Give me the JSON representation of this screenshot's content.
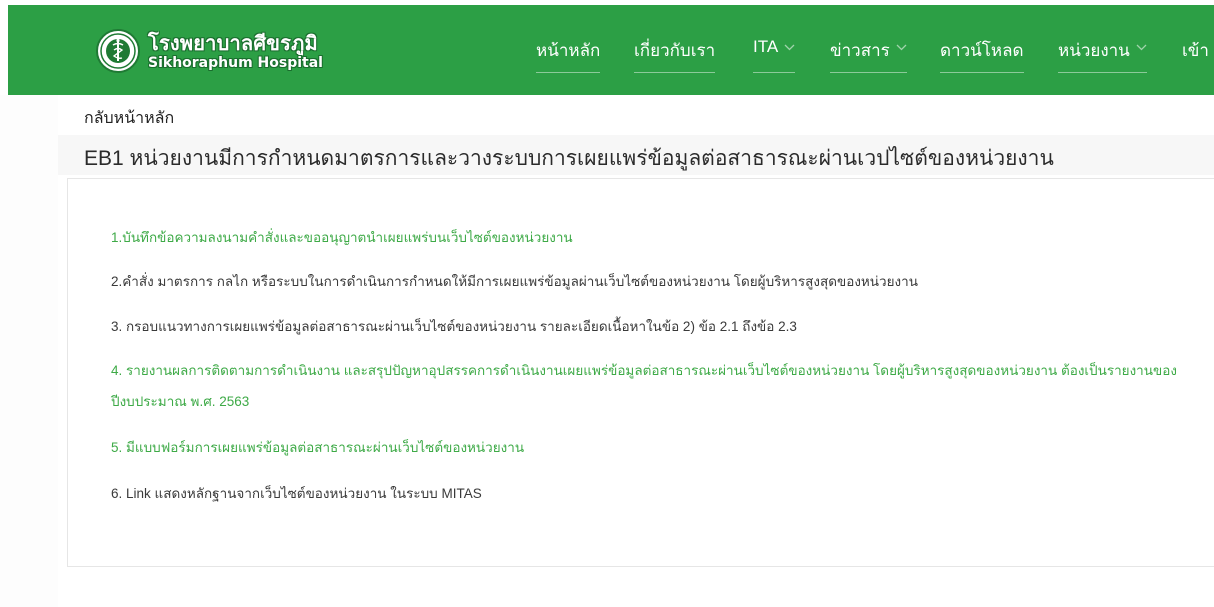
{
  "header": {
    "logo": {
      "title_thai": "โรงพยาบาลศีขรภูมิ",
      "title_english": "Sikhoraphum Hospital",
      "emblem_icon": "ministry-of-public-health-emblem-icon"
    },
    "nav": [
      {
        "label": "หน้าหลัก",
        "has_dropdown": false
      },
      {
        "label": "เกี่ยวกับเรา",
        "has_dropdown": false
      },
      {
        "label": "ITA",
        "has_dropdown": true
      },
      {
        "label": "ข่าวสาร",
        "has_dropdown": true
      },
      {
        "label": "ดาวน์โหลด",
        "has_dropdown": false
      },
      {
        "label": "หน่วยงาน",
        "has_dropdown": true
      },
      {
        "label": "เข้า",
        "has_dropdown": false
      }
    ],
    "background_color": "#2c9f45"
  },
  "breadcrumb": {
    "back_label": "กลับหน้าหลัก"
  },
  "page": {
    "title": "EB1 หน่วยงานมีการกำหนดมาตรการและวางระบบการเผยแพร่ข้อมูลต่อสาธารณะผ่านเวปไซต์ของหน่วยงาน"
  },
  "items": [
    {
      "text": "1.บันทึกข้อความลงนามคำสั่งและขออนุญาตนำเผยแพร่บนเว็บไซต์ของหน่วยงาน",
      "is_link": true
    },
    {
      "text": "2.คำสั่ง มาตรการ กลไก หรือระบบในการดำเนินการกำหนดให้มีการเผยแพร่ข้อมูลผ่านเว็บไซต์ของหน่วยงาน โดยผู้บริหารสูงสุดของหน่วยงาน",
      "is_link": false
    },
    {
      "text": "3. กรอบแนวทางการเผยแพร่ข้อมูลต่อสาธารณะผ่านเว็บไซต์ของหน่วยงาน รายละเอียดเนื้อหาในข้อ 2) ข้อ 2.1 ถึงข้อ 2.3",
      "is_link": false
    },
    {
      "text": "4. รายงานผลการติดตามการดำเนินงาน และสรุปปัญหาอุปสรรคการดำเนินงานเผยแพร่ข้อมูลต่อสาธารณะผ่านเว็บไซต์ของหน่วยงาน โดยผู้บริหารสูงสุดของหน่วยงาน ต้องเป็นรายงานของปีงบประมาณ พ.ศ. 2563",
      "is_link": true
    },
    {
      "text": "5. มีแบบฟอร์มการเผยแพร่ข้อมูลต่อสาธารณะผ่านเว็บไซต์ของหน่วยงาน",
      "is_link": true
    },
    {
      "text": "6. Link แสดงหลักฐานจากเว็บไซต์ของหน่วยงาน ในระบบ MITAS",
      "is_link": false
    }
  ],
  "colors": {
    "header_green": "#2c9f45",
    "link_green": "#3eaa47",
    "text_dark": "#3a3a3a"
  }
}
